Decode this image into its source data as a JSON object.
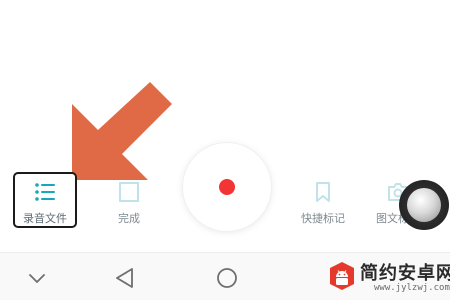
{
  "toolbar": {
    "recordings_label": "录音文件",
    "done_label": "完成",
    "quick_mark_label": "快捷标记",
    "photo_note_label": "图文标记"
  },
  "record_button": {
    "state": "idle"
  },
  "navbar": {
    "hide_icon": "chevron-down-icon",
    "back_icon": "triangle-back-icon",
    "home_icon": "circle-home-icon"
  },
  "watermark": {
    "title": "简约安卓网",
    "url": "www.jylzwj.com"
  },
  "colors": {
    "accent_teal": "#17a9b8",
    "record_red": "#f23434",
    "arrow_orange": "#e06a45",
    "highlight_border": "#1b1b1b",
    "label_gray": "#7f8a90"
  }
}
